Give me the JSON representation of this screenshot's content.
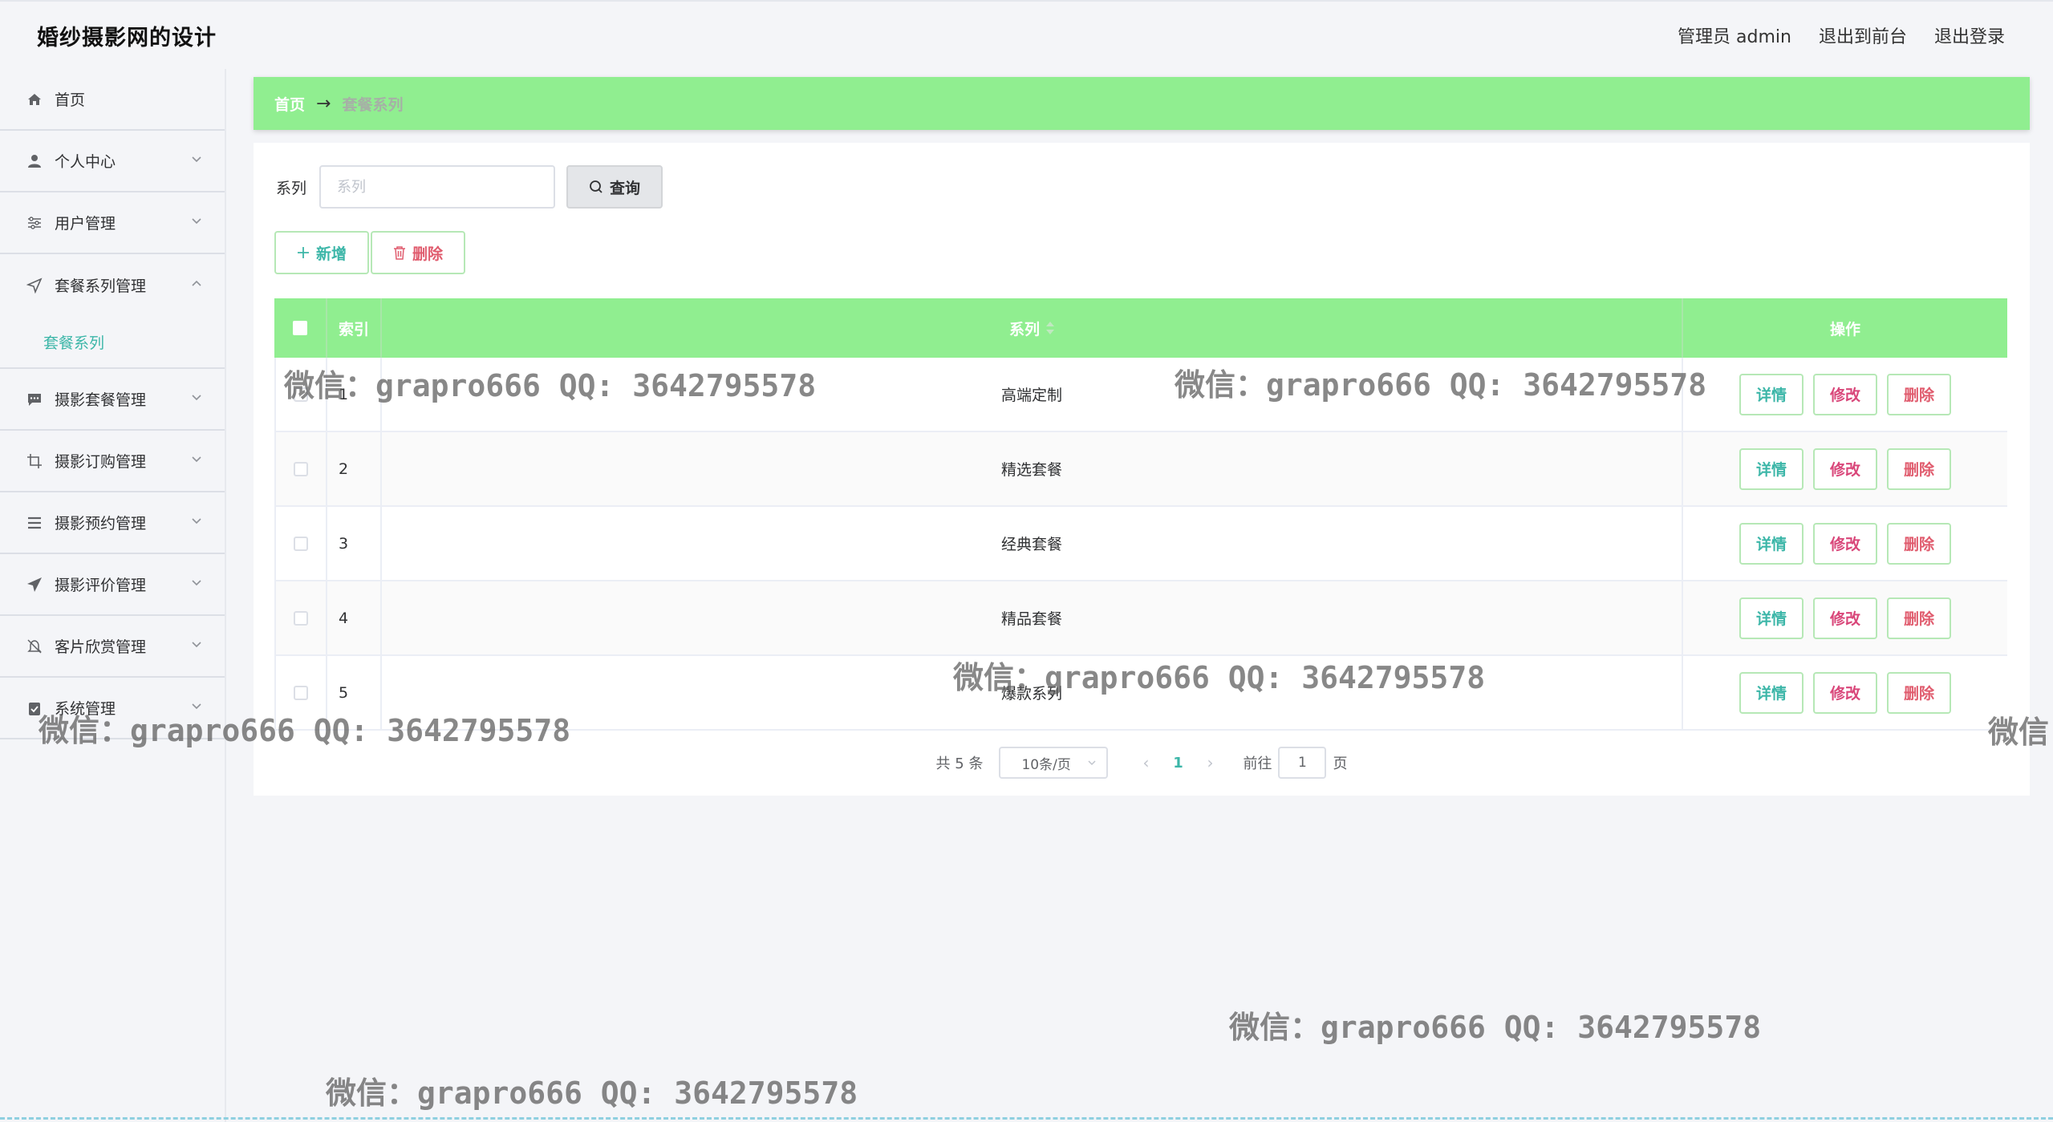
{
  "app": {
    "title": "婚纱摄影网的设计",
    "admin_label": "管理员 admin",
    "to_frontend": "退出到前台",
    "logout": "退出登录"
  },
  "sidebar": {
    "items": [
      {
        "label": "首页",
        "icon": "home-icon"
      },
      {
        "label": "个人中心",
        "icon": "user-icon"
      },
      {
        "label": "用户管理",
        "icon": "sliders-icon"
      },
      {
        "label": "套餐系列管理",
        "icon": "navigation-icon"
      },
      {
        "label": "摄影套餐管理",
        "icon": "chat-icon"
      },
      {
        "label": "摄影订购管理",
        "icon": "crop-icon"
      },
      {
        "label": "摄影预约管理",
        "icon": "list-icon"
      },
      {
        "label": "摄影评价管理",
        "icon": "send-icon"
      },
      {
        "label": "客片欣赏管理",
        "icon": "bell-off-icon"
      },
      {
        "label": "系统管理",
        "icon": "clipboard-check-icon"
      }
    ],
    "submenu_active": "套餐系列"
  },
  "breadcrumb": {
    "home": "首页",
    "current": "套餐系列"
  },
  "search": {
    "label": "系列",
    "placeholder": "系列",
    "button": "查询"
  },
  "actions": {
    "add": "新增",
    "delete": "删除"
  },
  "table": {
    "headers": {
      "index": "索引",
      "series": "系列",
      "ops": "操作"
    },
    "rows": [
      {
        "index": "1",
        "series": "高端定制"
      },
      {
        "index": "2",
        "series": "精选套餐"
      },
      {
        "index": "3",
        "series": "经典套餐"
      },
      {
        "index": "4",
        "series": "精品套餐"
      },
      {
        "index": "5",
        "series": "爆款系列"
      }
    ],
    "row_buttons": {
      "detail": "详情",
      "edit": "修改",
      "delete": "删除"
    }
  },
  "pager": {
    "total": "共 5 条",
    "page_size": "10条/页",
    "current_page": "1",
    "goto_label": "前往",
    "goto_value": "1",
    "page_suffix": "页"
  },
  "watermark": {
    "text": "微信：grapro666 QQ: 3642795578",
    "partial": "微信"
  },
  "colors": {
    "accent": "#90ee90",
    "teal": "#3cb6a8",
    "danger": "#e05c6e"
  }
}
